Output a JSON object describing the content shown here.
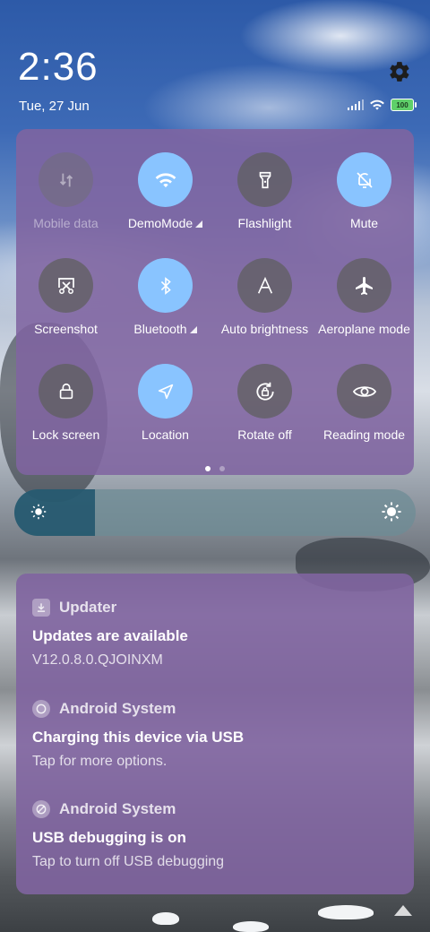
{
  "status": {
    "time": "2:36",
    "date": "Tue, 27 Jun",
    "battery": "100"
  },
  "quick_settings": {
    "tiles": [
      {
        "label": "Mobile data",
        "icon": "mobile-data-icon",
        "state": "disabled"
      },
      {
        "label": "DemoMode",
        "icon": "wifi-icon",
        "state": "on",
        "expandable": true
      },
      {
        "label": "Flashlight",
        "icon": "flashlight-icon",
        "state": "off"
      },
      {
        "label": "Mute",
        "icon": "bell-off-icon",
        "state": "on"
      },
      {
        "label": "Screenshot",
        "icon": "screenshot-icon",
        "state": "off"
      },
      {
        "label": "Bluetooth",
        "icon": "bluetooth-icon",
        "state": "on",
        "expandable": true
      },
      {
        "label": "Auto brightness",
        "icon": "auto-brightness-icon",
        "state": "off"
      },
      {
        "label": "Aeroplane mode",
        "icon": "airplane-icon",
        "state": "off"
      },
      {
        "label": "Lock screen",
        "icon": "lock-icon",
        "state": "off"
      },
      {
        "label": "Location",
        "icon": "location-icon",
        "state": "on"
      },
      {
        "label": "Rotate off",
        "icon": "rotate-lock-icon",
        "state": "off"
      },
      {
        "label": "Reading mode",
        "icon": "eye-icon",
        "state": "off"
      }
    ],
    "page_current": 1,
    "page_count": 2
  },
  "brightness": {
    "level": 0.2
  },
  "notifications": [
    {
      "app": "Updater",
      "title": "Updates are available",
      "text": "V12.0.8.0.QJOINXM"
    },
    {
      "app": "Android System",
      "title": "Charging this device via USB",
      "text": "Tap for more options."
    },
    {
      "app": "Android System",
      "title": "USB debugging is on",
      "text": "Tap to turn off USB debugging"
    }
  ],
  "colors": {
    "panel": "#8064a0",
    "tile_on": "#89c4ff",
    "tile_off": "#5f5f5f",
    "brightness_fill": "#195069"
  }
}
